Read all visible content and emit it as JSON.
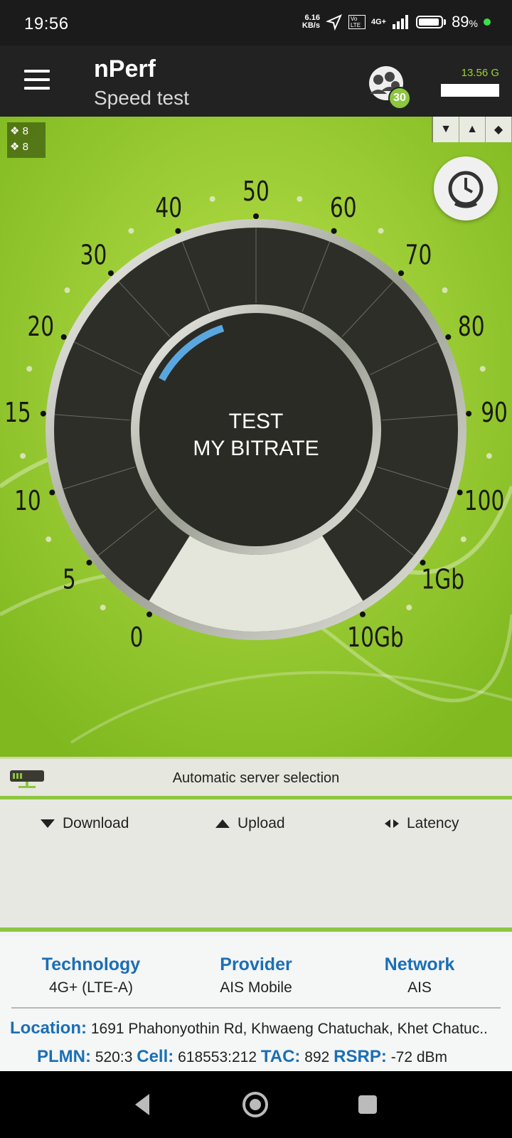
{
  "status": {
    "time": "19:56",
    "net_speed_value": "6.16",
    "net_speed_unit": "KB/s",
    "network_type": "4G+",
    "volte": "Vo LTE",
    "battery": "89",
    "battery_unit": "%"
  },
  "app": {
    "title": "nPerf",
    "subtitle": "Speed test",
    "community_count": "30",
    "data_used": "13.56 G"
  },
  "gauge": {
    "counters": [
      "8",
      "8"
    ],
    "center_label_line1": "TEST",
    "center_label_line2": "MY BITRATE",
    "scale": [
      "0",
      "5",
      "10",
      "15",
      "20",
      "30",
      "40",
      "50",
      "60",
      "70",
      "80",
      "90",
      "100",
      "1Gb",
      "10Gb"
    ],
    "mode_icons": [
      "download-mode-icon",
      "upload-mode-icon",
      "latency-mode-icon"
    ]
  },
  "server": {
    "label": "Automatic server selection"
  },
  "results": {
    "download_label": "Download",
    "upload_label": "Upload",
    "latency_label": "Latency"
  },
  "info": {
    "technology_label": "Technology",
    "technology_value": "4G+ (LTE-A)",
    "provider_label": "Provider",
    "provider_value": "AIS Mobile",
    "network_label": "Network",
    "network_value": "AIS",
    "location_label": "Location:",
    "location_value": "1691 Phahonyothin Rd, Khwaeng Chatuchak, Khet Chatuc..",
    "plmn_label": "PLMN:",
    "plmn_value": "520:3",
    "cell_label": "Cell:",
    "cell_value": "618553:212",
    "tac_label": "TAC:",
    "tac_value": "892",
    "rsrp_label": "RSRP:",
    "rsrp_value": "-72 dBm"
  },
  "colors": {
    "accent_green": "#8dc63f",
    "link_blue": "#1a6fb5",
    "gauge_dark": "#2d2e27"
  }
}
